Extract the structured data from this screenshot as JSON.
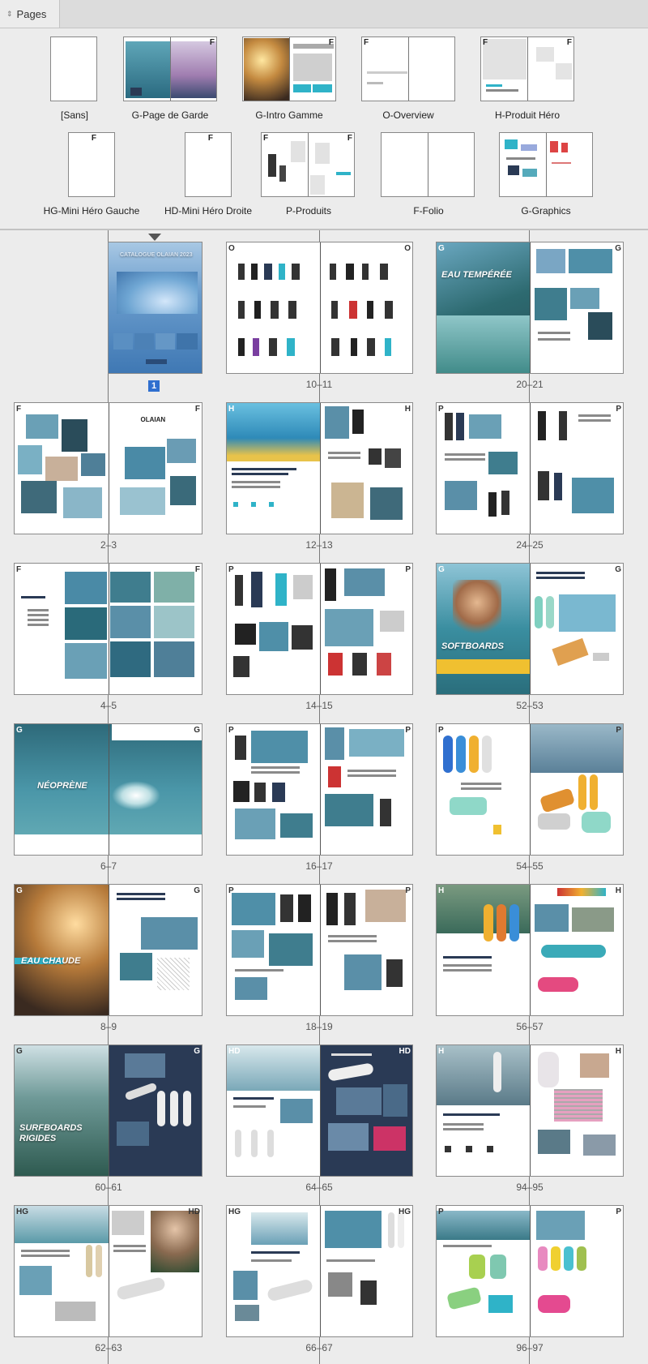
{
  "panel": {
    "tab_label": "Pages",
    "tab_icon": "collapse-chevron-icon"
  },
  "masters": [
    {
      "label": "[Sans]"
    },
    {
      "label": "G-Page de Garde",
      "prefix_r": "F"
    },
    {
      "label": "G-Intro Gamme",
      "prefix_r": "F"
    },
    {
      "label": "O-Overview",
      "prefix_l": "F"
    },
    {
      "label": "H-Produit Héro",
      "prefix_l": "F",
      "prefix_r": "F"
    },
    {
      "label": "HG-Mini Héro Gauche",
      "prefix_l": "F"
    },
    {
      "label": "HD-Mini Héro Droite",
      "prefix_l": "F"
    },
    {
      "label": "P-Produits",
      "prefix_l": "F",
      "prefix_r": "F"
    },
    {
      "label": "F-Folio"
    },
    {
      "label": "G-Graphics"
    }
  ],
  "spreads": [
    {
      "label": "1",
      "selected": true,
      "prefix_r": "",
      "title": "CATALOGUE OLAIAN 2023"
    },
    {
      "label": "10–11",
      "prefix_l": "O",
      "prefix_r": "O"
    },
    {
      "label": "20–21",
      "prefix_l": "G",
      "prefix_r": "G",
      "title": "EAU TEMPÉRÉE"
    },
    {
      "label": "2–3",
      "prefix_l": "F",
      "prefix_r": "F",
      "brand": "OLAIAN"
    },
    {
      "label": "12–13",
      "prefix_l": "H",
      "prefix_r": "H"
    },
    {
      "label": "24–25",
      "prefix_l": "P",
      "prefix_r": "P"
    },
    {
      "label": "4–5",
      "prefix_l": "F",
      "prefix_r": "F"
    },
    {
      "label": "14–15",
      "prefix_l": "P",
      "prefix_r": "P"
    },
    {
      "label": "52–53",
      "prefix_l": "G",
      "prefix_r": "G",
      "title": "SOFTBOARDS"
    },
    {
      "label": "6–7",
      "prefix_l": "G",
      "prefix_r": "G",
      "title": "NÉOPRÈNE"
    },
    {
      "label": "16–17",
      "prefix_l": "P",
      "prefix_r": "P"
    },
    {
      "label": "54–55",
      "prefix_l": "P",
      "prefix_r": "P"
    },
    {
      "label": "8–9",
      "prefix_l": "G",
      "prefix_r": "G",
      "title": "EAU CHAUDE"
    },
    {
      "label": "18–19",
      "prefix_l": "P",
      "prefix_r": "P"
    },
    {
      "label": "56–57",
      "prefix_l": "H",
      "prefix_r": "H"
    },
    {
      "label": "60–61",
      "prefix_l": "G",
      "prefix_r": "G",
      "title": "SURFBOARDS RIGIDES"
    },
    {
      "label": "64–65",
      "prefix_l": "HD",
      "prefix_r": "HD"
    },
    {
      "label": "94–95",
      "prefix_l": "H",
      "prefix_r": "H"
    },
    {
      "label": "62–63",
      "prefix_l": "HG",
      "prefix_r": "HD"
    },
    {
      "label": "66–67",
      "prefix_l": "HG",
      "prefix_r": "HG"
    },
    {
      "label": "96–97",
      "prefix_l": "P",
      "prefix_r": "P"
    }
  ],
  "colors": {
    "selection": "#2f6fcf",
    "panel_bg": "#ececec",
    "ocean": "#3a7fa0",
    "teal": "#2fb3c8",
    "navy": "#2a3a55"
  }
}
